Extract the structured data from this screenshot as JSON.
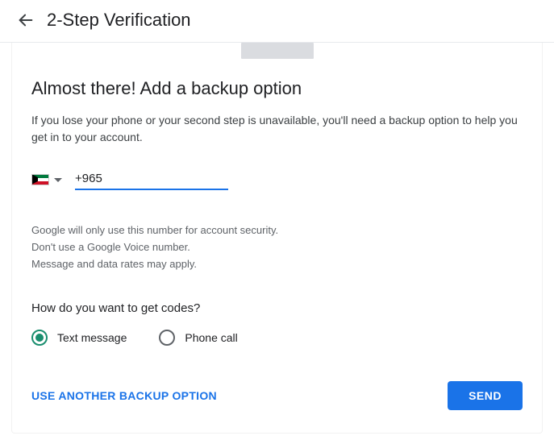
{
  "header": {
    "title": "2-Step Verification"
  },
  "main": {
    "title": "Almost there! Add a backup option",
    "description": "If you lose your phone or your second step is unavailable, you'll need a backup option to help you get in to your account.",
    "phone": {
      "country_code": "+965",
      "value": "+965 "
    },
    "disclaimer": {
      "line1": "Google will only use this number for account security.",
      "line2": "Don't use a Google Voice number.",
      "line3": "Message and data rates may apply."
    },
    "codes_question": "How do you want to get codes?",
    "options": {
      "text_message": "Text message",
      "phone_call": "Phone call"
    },
    "footer": {
      "alt_option": "USE ANOTHER BACKUP OPTION",
      "send": "SEND"
    }
  }
}
